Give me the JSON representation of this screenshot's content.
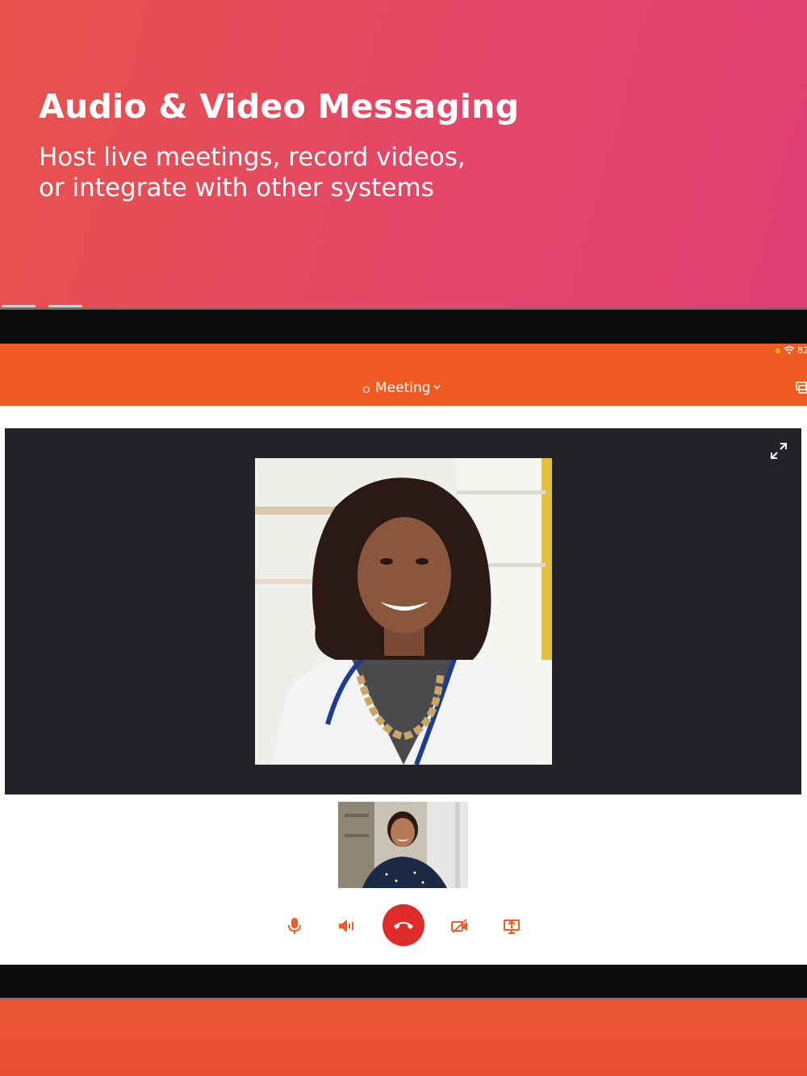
{
  "hero": {
    "title": "Audio & Video Messaging",
    "subtitle_line1": "Host live meetings, record videos,",
    "subtitle_line2": "or integrate with other systems"
  },
  "status_bar": {
    "battery": "82"
  },
  "navbar": {
    "title": "Meeting",
    "accent_color": "#f15a22"
  },
  "call_controls": {
    "hangup_color": "#e02b2b",
    "icon_color": "#f15a22"
  },
  "icons": {
    "mic": "microphone-icon",
    "speaker": "speaker-icon",
    "hangup": "phone-hangup-icon",
    "camera_off": "video-off-icon",
    "share": "screen-share-icon",
    "expand": "expand-icon",
    "window": "window-icon"
  }
}
